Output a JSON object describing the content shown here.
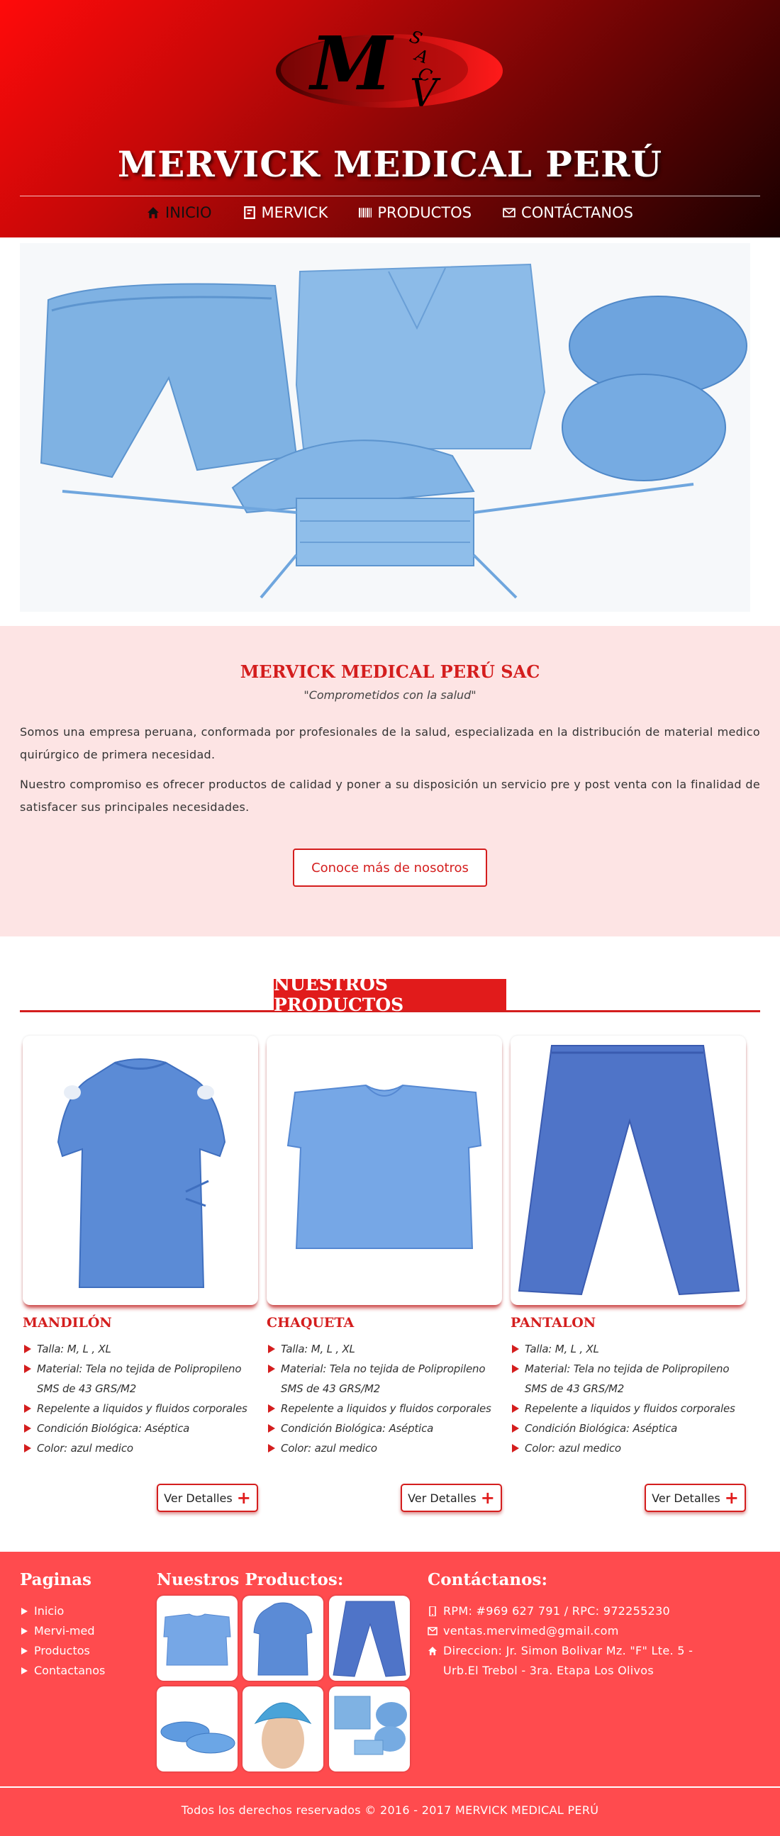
{
  "header": {
    "logo_letters": "M SAC V",
    "title": "MERVICK MEDICAL PERÚ",
    "nav": [
      {
        "label": "INICIO",
        "icon": "home-icon"
      },
      {
        "label": "MERVICK",
        "icon": "book-icon"
      },
      {
        "label": "PRODUCTOS",
        "icon": "barcode-icon"
      },
      {
        "label": "CONTÁCTANOS",
        "icon": "envelope-icon"
      }
    ]
  },
  "about": {
    "title": "MERVICK MEDICAL PERÚ SAC",
    "slogan": "\"Comprometidos con la salud\"",
    "paragraph1": "Somos una empresa peruana, conformada por profesionales de la salud, especializada en la distribución de material medico quirúrgico de primera necesidad.",
    "paragraph2": "Nuestro compromiso es ofrecer productos de calidad y poner a su disposición un servicio pre y post venta con la finalidad de satisfacer sus principales necesidades.",
    "button_label": "Conoce más de nosotros"
  },
  "products": {
    "section_title": "NUESTROS PRODUCTOS",
    "button_label": "Ver Detalles",
    "items": [
      {
        "name": "MANDILÓN",
        "features": [
          "Talla: M, L , XL",
          "Material: Tela no tejida de Polipropileno SMS de 43 GRS/M2",
          "Repelente a liquidos y fluidos corporales",
          "Condición Biológica: Aséptica",
          "Color: azul medico"
        ]
      },
      {
        "name": "CHAQUETA",
        "features": [
          "Talla: M, L , XL",
          "Material: Tela no tejida de Polipropileno SMS de 43 GRS/M2",
          "Repelente a liquidos y fluidos corporales",
          "Condición Biológica: Aséptica",
          "Color: azul medico"
        ]
      },
      {
        "name": "PANTALON",
        "features": [
          "Talla: M, L , XL",
          "Material: Tela no tejida de Polipropileno SMS de 43 GRS/M2",
          "Repelente a liquidos y fluidos corporales",
          "Condición Biológica: Aséptica",
          "Color: azul medico"
        ]
      }
    ]
  },
  "footer": {
    "pages_title": "Paginas",
    "pages_links": [
      "Inicio",
      "Mervi-med",
      "Productos",
      "Contactanos"
    ],
    "products_title": "Nuestros Productos:",
    "contact_title": "Contáctanos:",
    "phone": "RPM: #969 627 791 / RPC: 972255230",
    "email": "ventas.mervimed@gmail.com",
    "address": "Direccion: Jr. Simon Bolivar Mz. \"F\" Lte. 5 - Urb.El Trebol - 3ra. Etapa Los Olivos",
    "copyright": "Todos los derechos reservados © 2016 - 2017 MERVICK MEDICAL PERÚ"
  },
  "colors": {
    "brand_red": "#d41e1e",
    "footer_red": "#ff4b4e",
    "about_bg": "#fde4e4",
    "product_blue": "#5b8fd8"
  }
}
